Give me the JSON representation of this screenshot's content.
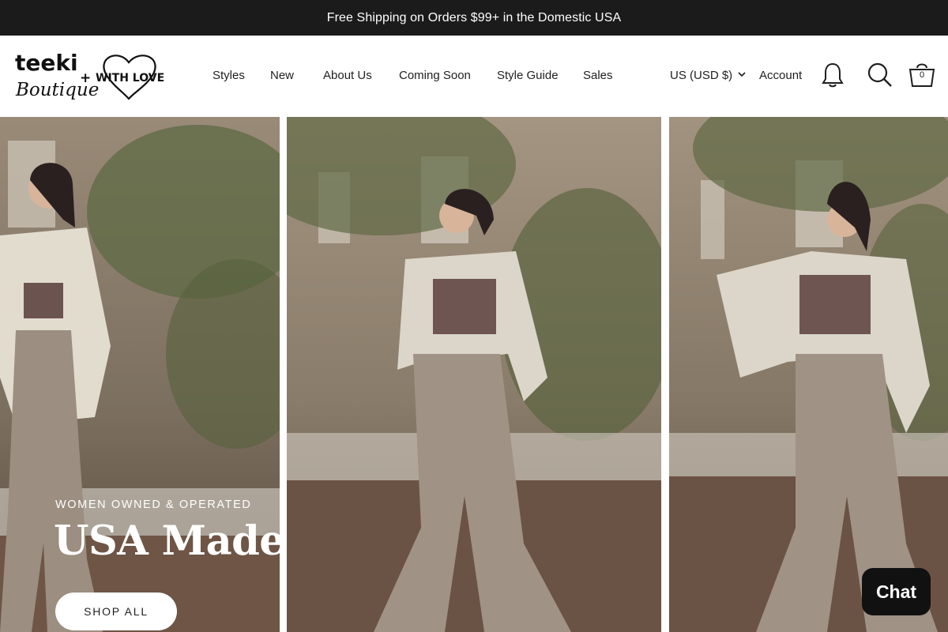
{
  "announcement": {
    "text": "Free Shipping on Orders $99+ in the Domestic USA"
  },
  "logo": {
    "line1": "teeki",
    "line2": "Boutique",
    "plus": "+",
    "partner": "WITH LOVE"
  },
  "nav": {
    "items": [
      {
        "label": "Styles"
      },
      {
        "label": "New"
      },
      {
        "label": "About Us"
      },
      {
        "label": "Coming Soon"
      },
      {
        "label": "Style Guide"
      },
      {
        "label": "Sales"
      }
    ]
  },
  "header": {
    "currency": "US (USD $)",
    "account": "Account",
    "cart_count": "0",
    "icons": {
      "notify": "bell-icon",
      "search": "search-icon",
      "cart": "cart-icon",
      "currency": "chevron-down-icon"
    }
  },
  "hero": {
    "eyebrow": "WOMEN OWNED & OPERATED",
    "headline": "USA Made",
    "cta": "SHOP ALL"
  },
  "chat": {
    "label": "Chat"
  },
  "colors": {
    "announcement_bg": "#1b1b1b",
    "chat_bg": "#111111",
    "text": "#1f1f1f"
  }
}
